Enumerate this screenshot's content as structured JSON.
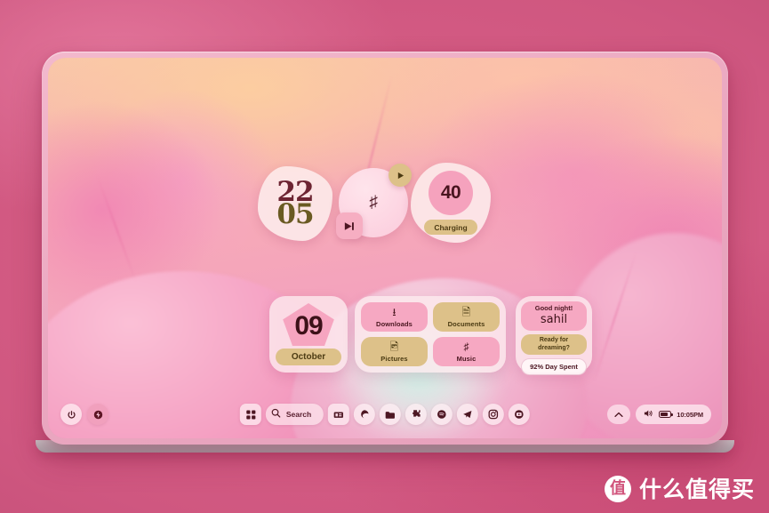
{
  "desktop": {
    "wallpaper_name": "abstract-pink-gradient-blobs",
    "accent_pink": "#f6a8c2",
    "accent_gold": "#ddc189",
    "text_dark": "#49161f"
  },
  "widgets": {
    "clock": {
      "name": "clock-widget",
      "hours": "22",
      "minutes": "05"
    },
    "music": {
      "name": "music-widget",
      "note_icon": "music-note-icon",
      "play_icon": "play-icon",
      "next_icon": "next-track-icon"
    },
    "battery": {
      "name": "battery-widget",
      "percent": "40",
      "status": "Charging"
    },
    "date": {
      "name": "date-widget",
      "day": "09",
      "month": "October"
    },
    "folders": {
      "name": "folder-shortcuts-widget",
      "tiles": [
        {
          "label": "Downloads",
          "icon": "download-icon",
          "tone": "pink"
        },
        {
          "label": "Documents",
          "icon": "document-icon",
          "tone": "gold"
        },
        {
          "label": "Pictures",
          "icon": "image-icon",
          "tone": "gold"
        },
        {
          "label": "Music",
          "icon": "music-note-icon",
          "tone": "pink"
        }
      ]
    },
    "greeting": {
      "name": "greeting-widget",
      "hello": "Good night!",
      "user": "sahil",
      "prompt_line1": "Ready for",
      "prompt_line2": "dreaming?",
      "day_spent": "92% Day Spent"
    }
  },
  "taskbar": {
    "left": [
      {
        "label": "Power",
        "icon": "power-icon"
      },
      {
        "label": "Power saver",
        "icon": "flash-icon"
      }
    ],
    "start": {
      "label": "Start",
      "icon": "start-grid-icon"
    },
    "search": {
      "icon": "search-icon",
      "placeholder": "Search",
      "value": "Search"
    },
    "apps": [
      {
        "label": "Widgets",
        "icon": "widgets-icon"
      },
      {
        "label": "Edge",
        "icon": "edge-icon"
      },
      {
        "label": "File Explorer",
        "icon": "folder-icon"
      },
      {
        "label": "Extensions",
        "icon": "puzzle-icon"
      },
      {
        "label": "Spotify",
        "icon": "spotify-icon"
      },
      {
        "label": "Telegram",
        "icon": "telegram-icon"
      },
      {
        "label": "Instagram",
        "icon": "instagram-icon"
      },
      {
        "label": "YouTube",
        "icon": "youtube-icon"
      }
    ],
    "tray": {
      "chevron": {
        "label": "Show hidden icons",
        "icon": "chevron-up-icon"
      },
      "volume_icon": "volume-icon",
      "battery_icon": "battery-icon",
      "clock": "10:05PM"
    }
  },
  "watermark": {
    "badge": "值",
    "text": "什么值得买"
  }
}
